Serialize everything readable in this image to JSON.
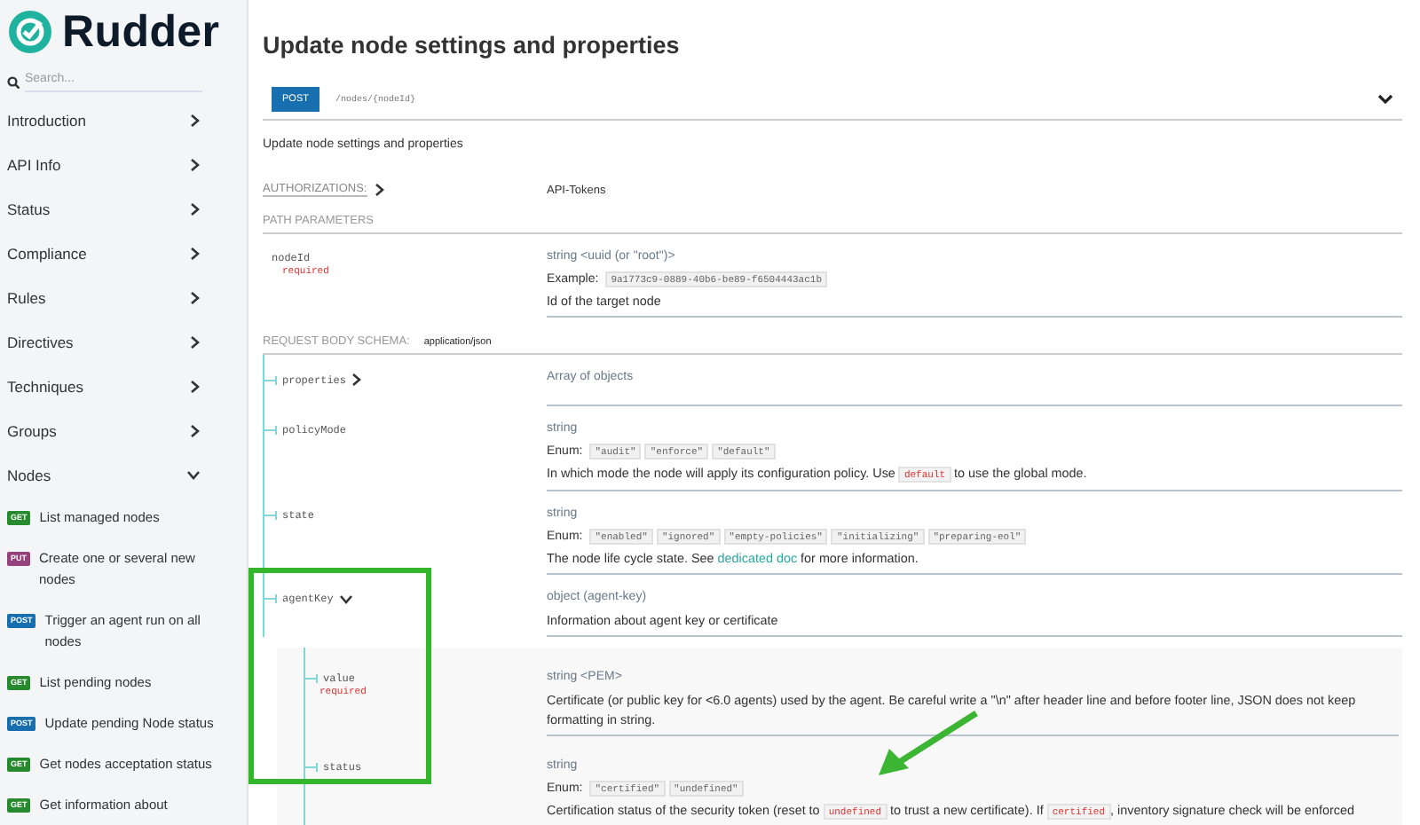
{
  "sidebar": {
    "logo": "Rudder",
    "search": {
      "placeholder": "Search..."
    },
    "sections": [
      {
        "label": "Introduction",
        "expanded": false
      },
      {
        "label": "API Info",
        "expanded": false
      },
      {
        "label": "Status",
        "expanded": false
      },
      {
        "label": "Compliance",
        "expanded": false
      },
      {
        "label": "Rules",
        "expanded": false
      },
      {
        "label": "Directives",
        "expanded": false
      },
      {
        "label": "Techniques",
        "expanded": false
      },
      {
        "label": "Groups",
        "expanded": false
      },
      {
        "label": "Nodes",
        "expanded": true
      }
    ],
    "operations": [
      {
        "method": "GET",
        "label": "List managed nodes"
      },
      {
        "method": "PUT",
        "label": "Create one or several new nodes"
      },
      {
        "method": "POST",
        "label": "Trigger an agent run on all nodes"
      },
      {
        "method": "GET",
        "label": "List pending nodes"
      },
      {
        "method": "POST",
        "label": "Update pending Node status"
      },
      {
        "method": "GET",
        "label": "Get nodes acceptation status"
      },
      {
        "method": "GET",
        "label": "Get information about"
      }
    ]
  },
  "main": {
    "title": "Update node settings and properties",
    "endpoint": {
      "method": "POST",
      "path": "/nodes/{nodeId}",
      "expanded": false
    },
    "description": "Update node settings and properties",
    "authorizations": {
      "label": "AUTHORIZATIONS:",
      "value": "API-Tokens"
    },
    "path_parameters": {
      "heading": "PATH PARAMETERS",
      "params": [
        {
          "name": "nodeId",
          "required": "required",
          "type": "string <uuid (or \"root\")>",
          "example_label": "Example:",
          "example": "9a1773c9-0889-40b6-be89-f6504443ac1b",
          "description": [
            {
              "kind": "text",
              "text": "Id of the target node"
            }
          ]
        }
      ]
    },
    "request_body": {
      "heading": "REQUEST BODY SCHEMA:",
      "content_type": "application/json",
      "fields": [
        {
          "name": "properties",
          "expanded": false,
          "type": "Array of objects"
        },
        {
          "name": "policyMode",
          "type": "string",
          "enum_label": "Enum:",
          "enum": [
            "\"audit\"",
            "\"enforce\"",
            "\"default\""
          ],
          "description": [
            {
              "kind": "text",
              "text": "In which mode the node will apply its configuration policy. Use "
            },
            {
              "kind": "code",
              "text": "default"
            },
            {
              "kind": "text",
              "text": " to use the global mode."
            }
          ]
        },
        {
          "name": "state",
          "type": "string",
          "enum_label": "Enum:",
          "enum": [
            "\"enabled\"",
            "\"ignored\"",
            "\"empty-policies\"",
            "\"initializing\"",
            "\"preparing-eol\""
          ],
          "description": [
            {
              "kind": "text",
              "text": "The node life cycle state. See "
            },
            {
              "kind": "link",
              "text": "dedicated doc"
            },
            {
              "kind": "text",
              "text": " for more information."
            }
          ]
        },
        {
          "name": "agentKey",
          "expanded": true,
          "type": "object (agent-key)",
          "description": [
            {
              "kind": "text",
              "text": "Information about agent key or certificate"
            }
          ],
          "children": [
            {
              "name": "value",
              "required": "required",
              "type": "string <PEM>",
              "description": [
                {
                  "kind": "text",
                  "text": "Certificate (or public key for <6.0 agents) used by the agent. Be careful write a \"\\n\" after header line and before footer line, JSON does not keep formatting in string."
                }
              ]
            },
            {
              "name": "status",
              "type": "string",
              "enum_label": "Enum:",
              "enum": [
                "\"certified\"",
                "\"undefined\""
              ],
              "description": [
                {
                  "kind": "text",
                  "text": "Certification status of the security token (reset to "
                },
                {
                  "kind": "code",
                  "text": "undefined"
                },
                {
                  "kind": "text",
                  "text": " to trust a new certificate). If "
                },
                {
                  "kind": "code",
                  "text": "certified"
                },
                {
                  "kind": "text",
                  "text": ", inventory signature check will be enforced"
                }
              ]
            }
          ]
        }
      ]
    }
  },
  "annotations": {
    "highlight_box": true,
    "arrow": true
  }
}
